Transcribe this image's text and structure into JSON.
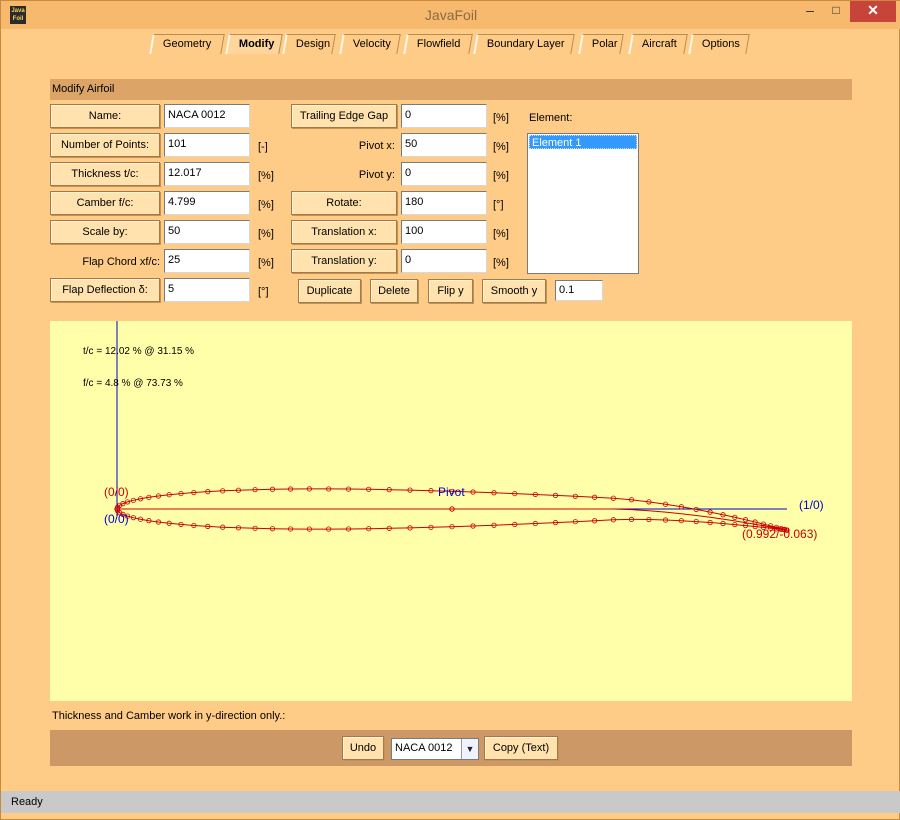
{
  "window": {
    "title": "JavaFoil",
    "icon_text": "Java Foil",
    "minimize_glyph": "–",
    "maximize_glyph": "□",
    "close_glyph": "✕"
  },
  "tabs": [
    {
      "label": "Geometry",
      "active": false
    },
    {
      "label": "Modify",
      "active": true
    },
    {
      "label": "Design",
      "active": false
    },
    {
      "label": "Velocity",
      "active": false
    },
    {
      "label": "Flowfield",
      "active": false
    },
    {
      "label": "Boundary Layer",
      "active": false
    },
    {
      "label": "Polar",
      "active": false
    },
    {
      "label": "Aircraft",
      "active": false
    },
    {
      "label": "Options",
      "active": false
    }
  ],
  "section": {
    "title": "Modify Airfoil"
  },
  "left_form": {
    "name_button": "Name:",
    "name_value": "NACA 0012",
    "points_button": "Number of Points:",
    "points_value": "101",
    "points_unit": "[-]",
    "thickness_button": "Thickness  t/c:",
    "thickness_value": "12.017",
    "thickness_unit": "[%]",
    "camber_button": "Camber  f/c:",
    "camber_value": "4.799",
    "camber_unit": "[%]",
    "scale_button": "Scale by:",
    "scale_value": "50",
    "scale_unit": "[%]",
    "flap_chord_label": "Flap Chord    xf/c:",
    "flap_chord_value": "25",
    "flap_chord_unit": "[%]",
    "flap_deflection_button": "Flap Deflection   δ:",
    "flap_deflection_value": "5",
    "flap_deflection_unit": "[°]"
  },
  "mid_form": {
    "te_gap_button": "Trailing Edge Gap",
    "te_gap_value": "0",
    "te_gap_unit": "[%]",
    "pivot_x_label": "Pivot x:",
    "pivot_x_value": "50",
    "pivot_x_unit": "[%]",
    "pivot_y_label": "Pivot y:",
    "pivot_y_value": "0",
    "pivot_y_unit": "[%]",
    "rotate_button": "Rotate:",
    "rotate_value": "180",
    "rotate_unit": "[°]",
    "translation_x_button": "Translation x:",
    "translation_x_value": "100",
    "translation_x_unit": "[%]",
    "translation_y_button": "Translation y:",
    "translation_y_value": "0",
    "translation_y_unit": "[%]"
  },
  "element": {
    "label": "Element:",
    "items": [
      "Element 1"
    ]
  },
  "actions": {
    "duplicate": "Duplicate",
    "delete": "Delete",
    "flip_y": "Flip y",
    "smooth_y": "Smooth y",
    "smooth_value": "0.1"
  },
  "plot": {
    "thickness_info": "t/c = 12.02 % @ 31.15 %",
    "camber_info": "f/c = 4.8 % @ 73.73 %",
    "label_origin_upper": "(0/0)",
    "label_origin_lower": "(0/0)",
    "label_pivot": "Pivot",
    "label_one": "(1/0)",
    "label_te": "(0.992/-0.063)",
    "curve_color": "#cc0000",
    "axis_color": "#0000cc"
  },
  "hint": "Thickness and Camber work in y-direction only.:",
  "bottom": {
    "undo": "Undo",
    "combo_value": "NACA 0012",
    "copy": "Copy (Text)"
  },
  "status": "Ready"
}
